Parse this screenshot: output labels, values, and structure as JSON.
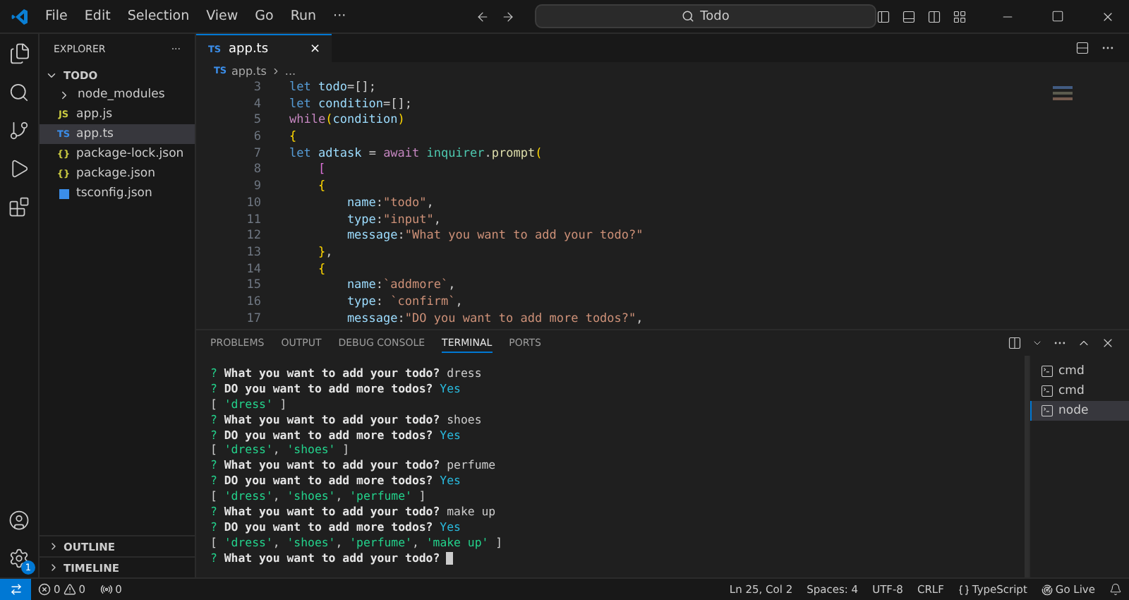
{
  "menu": [
    "File",
    "Edit",
    "Selection",
    "View",
    "Go",
    "Run",
    "···"
  ],
  "search": {
    "value": "Todo"
  },
  "sidebar": {
    "title": "EXPLORER",
    "more": "···",
    "root": {
      "label": "TODO",
      "expanded": true,
      "children": [
        {
          "label": "node_modules",
          "kind": "folder",
          "selected": false
        },
        {
          "label": "app.js",
          "kind": "js",
          "glyph": "JS",
          "selected": false
        },
        {
          "label": "app.ts",
          "kind": "ts",
          "glyph": "TS",
          "selected": true
        },
        {
          "label": "package-lock.json",
          "kind": "json",
          "glyph": "{}",
          "selected": false
        },
        {
          "label": "package.json",
          "kind": "json",
          "glyph": "{}",
          "selected": false
        },
        {
          "label": "tsconfig.json",
          "kind": "config",
          "selected": false
        }
      ]
    },
    "sections": [
      {
        "label": "OUTLINE",
        "expanded": false
      },
      {
        "label": "TIMELINE",
        "expanded": false
      }
    ]
  },
  "settings_badge": "1",
  "editor": {
    "tab": {
      "glyph": "TS",
      "label": "app.ts",
      "close": "×"
    },
    "breadcrumb": [
      {
        "glyph": "TS",
        "label": "app.ts"
      },
      {
        "label": "..."
      }
    ],
    "lines": [
      {
        "n": "3",
        "tokens": [
          {
            "t": "let ",
            "kind": "kw"
          },
          {
            "t": "todo",
            "kind": "var"
          },
          {
            "t": "=[];",
            "kind": "punct"
          }
        ]
      },
      {
        "n": "4",
        "tokens": [
          {
            "t": "let ",
            "kind": "kw"
          },
          {
            "t": "condition",
            "kind": "var"
          },
          {
            "t": "=[];",
            "kind": "punct"
          }
        ]
      },
      {
        "n": "5",
        "tokens": [
          {
            "t": "while",
            "kind": "ctrl"
          },
          {
            "t": "(",
            "kind": "brace"
          },
          {
            "t": "condition",
            "kind": "var"
          },
          {
            "t": ")",
            "kind": "brace"
          }
        ]
      },
      {
        "n": "6",
        "tokens": [
          {
            "t": "{",
            "kind": "brace"
          }
        ]
      },
      {
        "n": "7",
        "tokens": [
          {
            "t": "let ",
            "kind": "kw"
          },
          {
            "t": "adtask",
            "kind": "var"
          },
          {
            "t": " = ",
            "kind": "punct"
          },
          {
            "t": "await ",
            "kind": "ctrl"
          },
          {
            "t": "inquirer",
            "kind": "type"
          },
          {
            "t": ".",
            "kind": "punct"
          },
          {
            "t": "prompt",
            "kind": "func"
          },
          {
            "t": "(",
            "kind": "brace"
          }
        ]
      },
      {
        "n": "8",
        "tokens": [
          {
            "t": "    [",
            "kind": "brace2"
          }
        ]
      },
      {
        "n": "9",
        "tokens": [
          {
            "t": "    {",
            "kind": "brace"
          }
        ]
      },
      {
        "n": "10",
        "tokens": [
          {
            "t": "        name",
            "kind": "var"
          },
          {
            "t": ":",
            "kind": "punct"
          },
          {
            "t": "\"todo\"",
            "kind": "str"
          },
          {
            "t": ",",
            "kind": "punct"
          }
        ]
      },
      {
        "n": "11",
        "tokens": [
          {
            "t": "        type",
            "kind": "var"
          },
          {
            "t": ":",
            "kind": "punct"
          },
          {
            "t": "\"input\"",
            "kind": "str"
          },
          {
            "t": ",",
            "kind": "punct"
          }
        ]
      },
      {
        "n": "12",
        "tokens": [
          {
            "t": "        message",
            "kind": "var"
          },
          {
            "t": ":",
            "kind": "punct"
          },
          {
            "t": "\"What you want to add your todo?\"",
            "kind": "str"
          }
        ]
      },
      {
        "n": "13",
        "tokens": [
          {
            "t": "    }",
            "kind": "brace"
          },
          {
            "t": ",",
            "kind": "punct"
          }
        ]
      },
      {
        "n": "14",
        "tokens": [
          {
            "t": "    {",
            "kind": "brace"
          }
        ]
      },
      {
        "n": "15",
        "tokens": [
          {
            "t": "        name",
            "kind": "var"
          },
          {
            "t": ":",
            "kind": "punct"
          },
          {
            "t": "`addmore`",
            "kind": "str"
          },
          {
            "t": ",",
            "kind": "punct"
          }
        ]
      },
      {
        "n": "16",
        "tokens": [
          {
            "t": "        type",
            "kind": "var"
          },
          {
            "t": ": ",
            "kind": "punct"
          },
          {
            "t": "`confirm`",
            "kind": "str"
          },
          {
            "t": ",",
            "kind": "punct"
          }
        ]
      },
      {
        "n": "17",
        "tokens": [
          {
            "t": "        message",
            "kind": "var"
          },
          {
            "t": ":",
            "kind": "punct"
          },
          {
            "t": "\"DO you want to add more todos?\"",
            "kind": "str"
          },
          {
            "t": ",",
            "kind": "punct"
          }
        ]
      }
    ]
  },
  "panel": {
    "tabs": [
      {
        "label": "PROBLEMS",
        "selected": false
      },
      {
        "label": "OUTPUT",
        "selected": false
      },
      {
        "label": "DEBUG CONSOLE",
        "selected": false
      },
      {
        "label": "TERMINAL",
        "selected": true
      },
      {
        "label": "PORTS",
        "selected": false
      }
    ],
    "terminal": [
      [
        {
          "t": "? ",
          "kind": "q"
        },
        {
          "t": "What you want to add your todo?",
          "kind": "b"
        },
        {
          "t": " dress",
          "kind": "n"
        }
      ],
      [
        {
          "t": "? ",
          "kind": "q"
        },
        {
          "t": "DO you want to add more todos?",
          "kind": "b"
        },
        {
          "t": " Yes",
          "kind": "c"
        }
      ],
      [
        {
          "t": "[ ",
          "kind": "n"
        },
        {
          "t": "'dress'",
          "kind": "s"
        },
        {
          "t": " ]",
          "kind": "n"
        }
      ],
      [
        {
          "t": "? ",
          "kind": "q"
        },
        {
          "t": "What you want to add your todo?",
          "kind": "b"
        },
        {
          "t": " shoes",
          "kind": "n"
        }
      ],
      [
        {
          "t": "? ",
          "kind": "q"
        },
        {
          "t": "DO you want to add more todos?",
          "kind": "b"
        },
        {
          "t": " Yes",
          "kind": "c"
        }
      ],
      [
        {
          "t": "[ ",
          "kind": "n"
        },
        {
          "t": "'dress'",
          "kind": "s"
        },
        {
          "t": ", ",
          "kind": "n"
        },
        {
          "t": "'shoes'",
          "kind": "s"
        },
        {
          "t": " ]",
          "kind": "n"
        }
      ],
      [
        {
          "t": "? ",
          "kind": "q"
        },
        {
          "t": "What you want to add your todo?",
          "kind": "b"
        },
        {
          "t": " perfume",
          "kind": "n"
        }
      ],
      [
        {
          "t": "? ",
          "kind": "q"
        },
        {
          "t": "DO you want to add more todos?",
          "kind": "b"
        },
        {
          "t": " Yes",
          "kind": "c"
        }
      ],
      [
        {
          "t": "[ ",
          "kind": "n"
        },
        {
          "t": "'dress'",
          "kind": "s"
        },
        {
          "t": ", ",
          "kind": "n"
        },
        {
          "t": "'shoes'",
          "kind": "s"
        },
        {
          "t": ", ",
          "kind": "n"
        },
        {
          "t": "'perfume'",
          "kind": "s"
        },
        {
          "t": " ]",
          "kind": "n"
        }
      ],
      [
        {
          "t": "? ",
          "kind": "q"
        },
        {
          "t": "What you want to add your todo?",
          "kind": "b"
        },
        {
          "t": " make up",
          "kind": "n"
        }
      ],
      [
        {
          "t": "? ",
          "kind": "q"
        },
        {
          "t": "DO you want to add more todos?",
          "kind": "b"
        },
        {
          "t": " Yes",
          "kind": "c"
        }
      ],
      [
        {
          "t": "[ ",
          "kind": "n"
        },
        {
          "t": "'dress'",
          "kind": "s"
        },
        {
          "t": ", ",
          "kind": "n"
        },
        {
          "t": "'shoes'",
          "kind": "s"
        },
        {
          "t": ", ",
          "kind": "n"
        },
        {
          "t": "'perfume'",
          "kind": "s"
        },
        {
          "t": ", ",
          "kind": "n"
        },
        {
          "t": "'make up'",
          "kind": "s"
        },
        {
          "t": " ]",
          "kind": "n"
        }
      ],
      [
        {
          "t": "? ",
          "kind": "q"
        },
        {
          "t": "What you want to add your todo?",
          "kind": "b"
        }
      ]
    ],
    "terminals": [
      {
        "label": "cmd",
        "selected": false
      },
      {
        "label": "cmd",
        "selected": false
      },
      {
        "label": "node",
        "selected": true
      }
    ]
  },
  "status_bar": {
    "errors": "0",
    "warnings": "0",
    "ports": "0",
    "right": [
      "Ln 25, Col 2",
      "Spaces: 4",
      "UTF-8",
      "CRLF",
      "TypeScript",
      "Go Live"
    ]
  }
}
